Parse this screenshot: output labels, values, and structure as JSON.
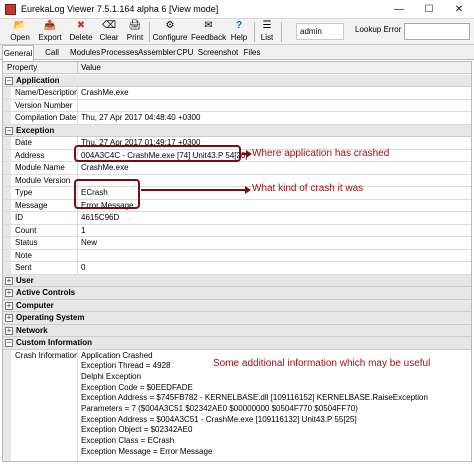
{
  "window": {
    "title": "EurekaLog Viewer 7.5.1.164 alpha 6 [View mode]",
    "minimize": "—",
    "maximize": "☐",
    "close": "✕"
  },
  "toolbar": {
    "buttons": [
      {
        "label": "Open",
        "icon": "open-folder-icon",
        "glyph": "📂"
      },
      {
        "label": "Export",
        "icon": "export-icon",
        "glyph": "📤"
      },
      {
        "label": "Delete",
        "icon": "delete-icon",
        "glyph": "✖"
      },
      {
        "label": "Clear",
        "icon": "clear-icon",
        "glyph": "⌫"
      },
      {
        "label": "Print",
        "icon": "print-icon",
        "glyph": "🖨"
      },
      {
        "label": "Configure",
        "icon": "configure-icon",
        "glyph": "⚙"
      },
      {
        "label": "Feedback",
        "icon": "feedback-icon",
        "glyph": "✉"
      },
      {
        "label": "Help",
        "icon": "help-icon",
        "glyph": "?"
      },
      {
        "label": "List",
        "icon": "list-icon",
        "glyph": "☰"
      }
    ],
    "user": "admin",
    "lookup_label": "Lookup Error"
  },
  "tabs": [
    "General",
    "Call Stack",
    "Modules",
    "Processes",
    "Assembler",
    "CPU",
    "Screenshot",
    "Files"
  ],
  "grid": {
    "col_property": "Property",
    "col_value": "Value",
    "groups": [
      {
        "name": "Application",
        "expanded": true,
        "rows": [
          {
            "name": "Name/Description",
            "value": "CrashMe.exe"
          },
          {
            "name": "Version Number",
            "value": ""
          },
          {
            "name": "Compilation Date",
            "value": "Thu, 27 Apr 2017 04:48:40 +0300"
          }
        ]
      },
      {
        "name": "Exception",
        "expanded": true,
        "rows": [
          {
            "name": "Date",
            "value": "Thu, 27 Apr 2017 01:49:17 +0300"
          },
          {
            "name": "Address",
            "value": "004A3C4C - CrashMe.exe [74] Unit43.P 54[20]"
          },
          {
            "name": "Module Name",
            "value": "CrashMe.exe"
          },
          {
            "name": "Module Version",
            "value": ""
          },
          {
            "name": "Type",
            "value": "ECrash"
          },
          {
            "name": "Message",
            "value": "Error Message"
          },
          {
            "name": "ID",
            "value": "4615C96D"
          },
          {
            "name": "Count",
            "value": "1"
          },
          {
            "name": "Status",
            "value": "New"
          },
          {
            "name": "Note",
            "value": ""
          },
          {
            "name": "Sent",
            "value": "0"
          }
        ]
      }
    ],
    "collapsed_groups": [
      "User",
      "Active Controls",
      "Computer",
      "Operating System",
      "Network"
    ],
    "custom_group": "Custom Information",
    "crash_info_name": "Crash Information",
    "crash_info_lines": [
      "Application Crashed",
      "Exception Thread = 4928",
      "Delphi Exception",
      "Exception Code = $0EEDFADE",
      "Exception Address = $745FB782 - KERNELBASE.dll [109116152] KERNELBASE.RaiseException",
      "Parameters = 7 ($004A3C51 $02342AE0 $00000000 $0504F770 $0504FF70)",
      "Exception Address = $004A3C51 - CrashMe.exe [109116132] Unit43.P 55[25]",
      "Exception Object = $02342AE0",
      "Exception Class = ECrash",
      "Exception Message = Error Message"
    ]
  },
  "annotations": {
    "crash_location": "Where application has crashed",
    "crash_kind": "What kind of crash it was",
    "additional_info": "Some additional information which may be useful"
  },
  "colors": {
    "annotation": "#a01010",
    "annotation_border": "#7a0e0e"
  }
}
